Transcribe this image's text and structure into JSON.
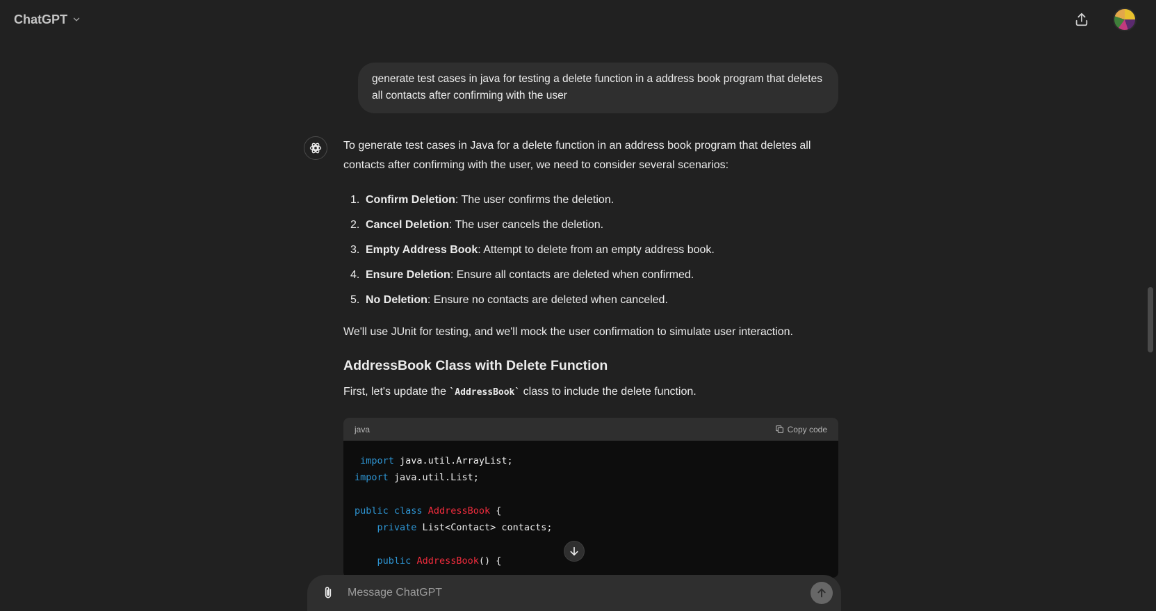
{
  "header": {
    "model_name": "ChatGPT"
  },
  "user_message": "generate test cases in java for testing a delete function in a address book program that deletes all contacts after confirming with the user",
  "assistant": {
    "intro": "To generate test cases in Java for a delete function in an address book program that deletes all contacts after confirming with the user, we need to consider several scenarios:",
    "items": [
      {
        "num": "1.",
        "title": "Confirm Deletion",
        "text": ": The user confirms the deletion."
      },
      {
        "num": "2.",
        "title": "Cancel Deletion",
        "text": ": The user cancels the deletion."
      },
      {
        "num": "3.",
        "title": "Empty Address Book",
        "text": ": Attempt to delete from an empty address book."
      },
      {
        "num": "4.",
        "title": "Ensure Deletion",
        "text": ": Ensure all contacts are deleted when confirmed."
      },
      {
        "num": "5.",
        "title": "No Deletion",
        "text": ": Ensure no contacts are deleted when canceled."
      }
    ],
    "junit_note": "We'll use JUnit for testing, and we'll mock the user confirmation to simulate user interaction.",
    "section_heading": "AddressBook Class with Delete Function",
    "section_text_before": "First, let's update the ",
    "section_code": "`AddressBook`",
    "section_text_after": " class to include the delete function."
  },
  "code_block": {
    "language": "java",
    "copy_label": "Copy code"
  },
  "composer": {
    "placeholder": "Message ChatGPT"
  },
  "icons": {
    "chevron": "chevron-down-icon",
    "share": "share-icon",
    "attach": "paperclip-icon",
    "send": "arrow-up-icon",
    "scroll": "arrow-down-icon",
    "copy": "copy-icon",
    "assistant": "openai-logo-icon"
  }
}
